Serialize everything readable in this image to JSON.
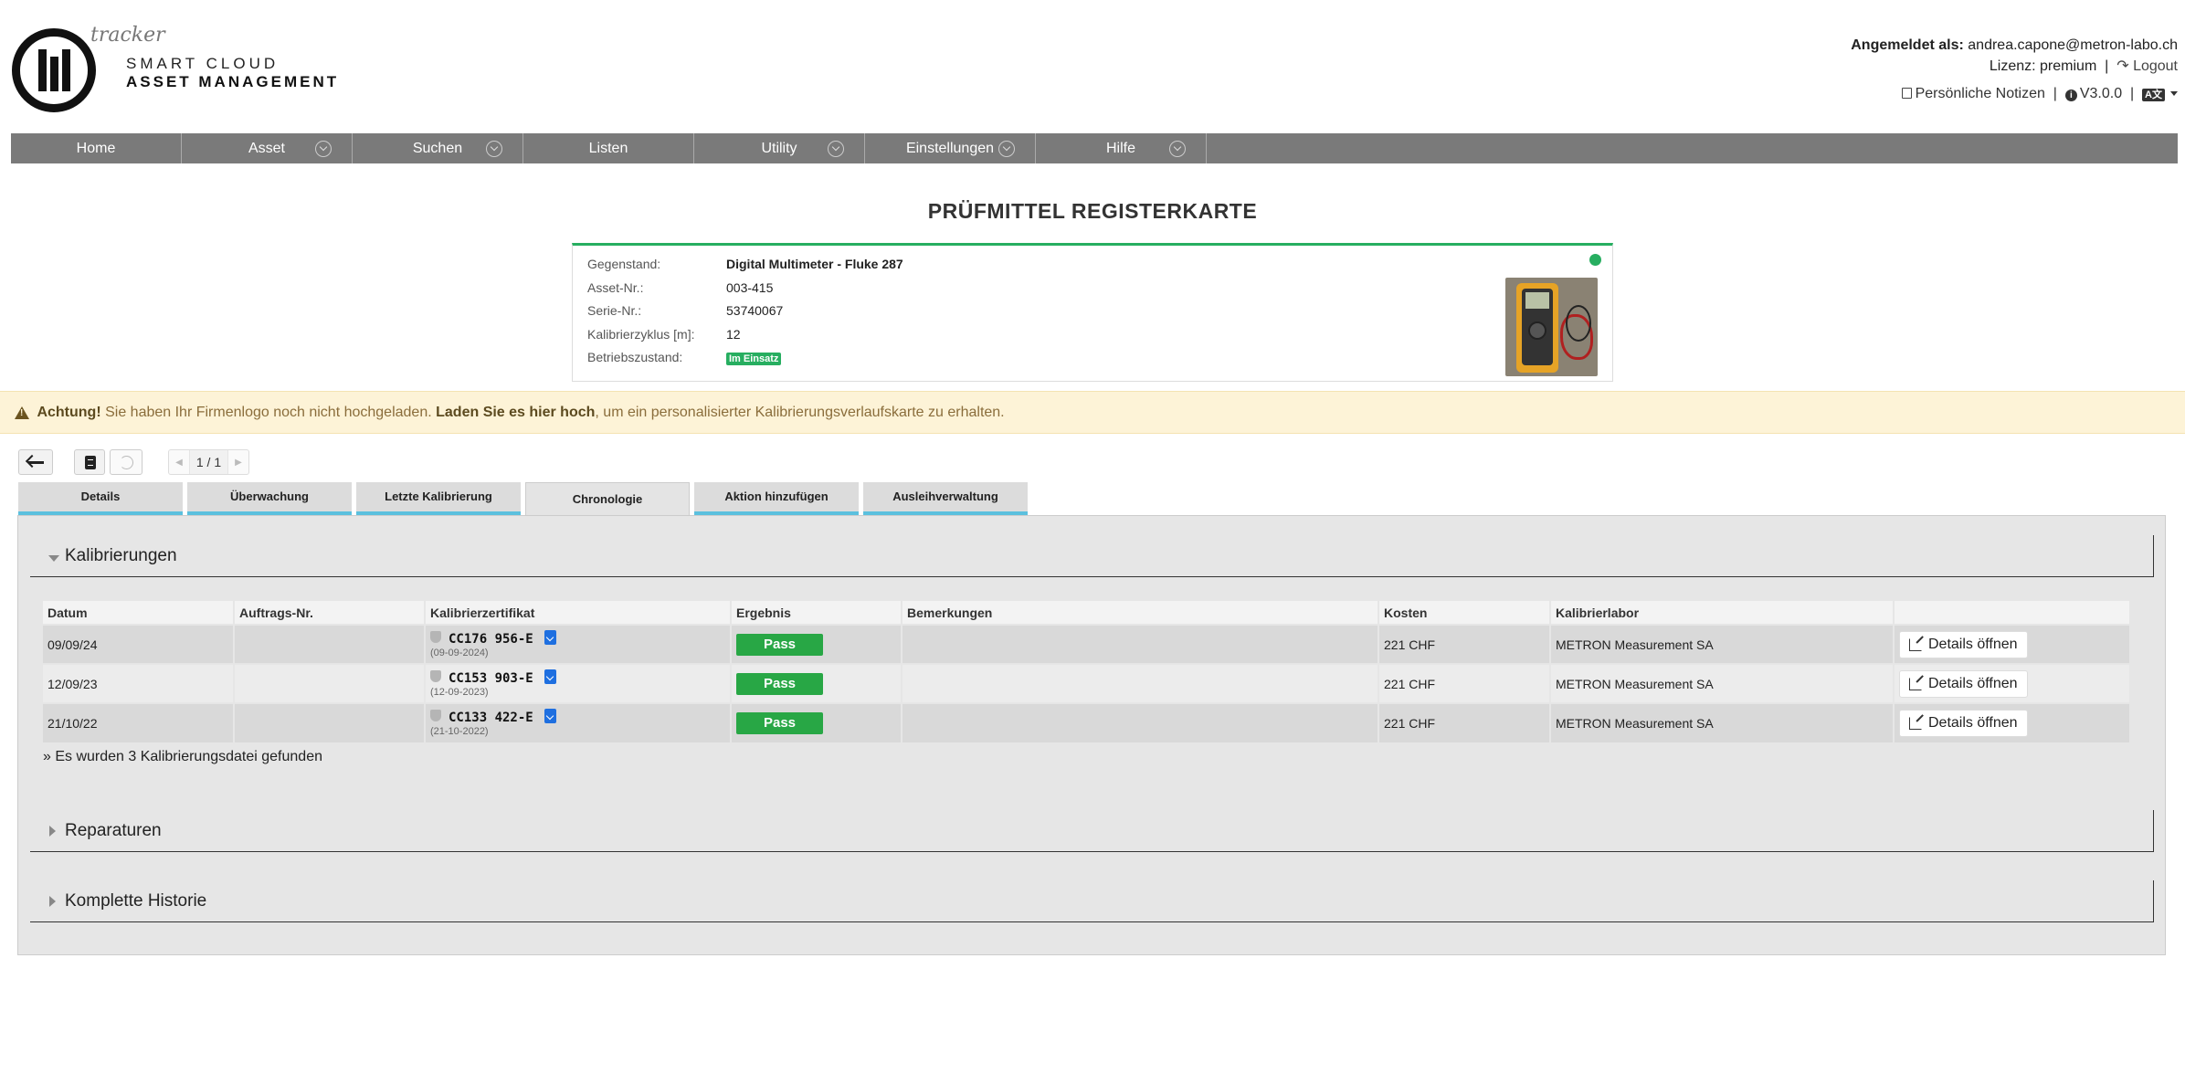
{
  "brand": {
    "tracker": "tracker",
    "line1": "SMART CLOUD",
    "line2": "ASSET MANAGEMENT"
  },
  "user": {
    "logged_in_label": "Angemeldet als:",
    "email": "andrea.capone@metron-labo.ch",
    "license_label": "Lizenz:",
    "license": "premium",
    "separator": "|",
    "logout": "Logout",
    "notes": "Persönliche Notizen",
    "version": "V3.0.0",
    "language_icon": "language-icon"
  },
  "nav": [
    {
      "label": "Home",
      "dropdown": false
    },
    {
      "label": "Asset",
      "dropdown": true
    },
    {
      "label": "Suchen",
      "dropdown": true
    },
    {
      "label": "Listen",
      "dropdown": false
    },
    {
      "label": "Utility",
      "dropdown": true
    },
    {
      "label": "Einstellungen",
      "dropdown": true
    },
    {
      "label": "Hilfe",
      "dropdown": true
    }
  ],
  "page_title": "PRÜFMITTEL REGISTERKARTE",
  "asset": {
    "fields": [
      {
        "label": "Gegenstand:",
        "value": "Digital Multimeter - Fluke 287"
      },
      {
        "label": "Asset-Nr.:",
        "value": "003-415"
      },
      {
        "label": "Serie-Nr.:",
        "value": "53740067"
      },
      {
        "label": "Kalibrierzyklus [m]:",
        "value": "12"
      },
      {
        "label": "Betriebszustand:",
        "value": "Im Einsatz"
      }
    ],
    "status_color": "#27ae60"
  },
  "warning": {
    "strong1": "Achtung!",
    "text1": " Sie haben Ihr Firmenlogo noch nicht hochgeladen. ",
    "strong2": "Laden Sie es hier hoch",
    "text2": ", um ein personalisierter Kalibrierungsverlaufskarte zu erhalten."
  },
  "pager": "1 / 1",
  "tabs": [
    {
      "label": "Details",
      "active": false
    },
    {
      "label": "Überwachung",
      "active": false
    },
    {
      "label": "Letzte Kalibrierung",
      "active": false
    },
    {
      "label": "Chronologie",
      "active": true
    },
    {
      "label": "Aktion hinzufügen",
      "active": false
    },
    {
      "label": "Ausleihverwaltung",
      "active": false
    }
  ],
  "sections": {
    "calibrations": "Kalibrierungen",
    "repairs": "Reparaturen",
    "history": "Komplette Historie"
  },
  "table": {
    "headers": [
      "Datum",
      "Auftrags-Nr.",
      "Kalibrierzertifikat",
      "Ergebnis",
      "Bemerkungen",
      "Kosten",
      "Kalibrierlabor",
      ""
    ],
    "rows": [
      {
        "date": "09/09/24",
        "order": "",
        "cert": "CC176 956-E",
        "cert_date": "(09-09-2024)",
        "result": "Pass",
        "remarks": "",
        "cost": "221 CHF",
        "lab": "METRON Measurement SA",
        "action": "Details öffnen"
      },
      {
        "date": "12/09/23",
        "order": "",
        "cert": "CC153 903-E",
        "cert_date": "(12-09-2023)",
        "result": "Pass",
        "remarks": "",
        "cost": "221 CHF",
        "lab": "METRON Measurement SA",
        "action": "Details öffnen"
      },
      {
        "date": "21/10/22",
        "order": "",
        "cert": "CC133 422-E",
        "cert_date": "(21-10-2022)",
        "result": "Pass",
        "remarks": "",
        "cost": "221 CHF",
        "lab": "METRON Measurement SA",
        "action": "Details öffnen"
      }
    ],
    "found_note": "» Es wurden 3 Kalibrierungsdatei gefunden"
  }
}
